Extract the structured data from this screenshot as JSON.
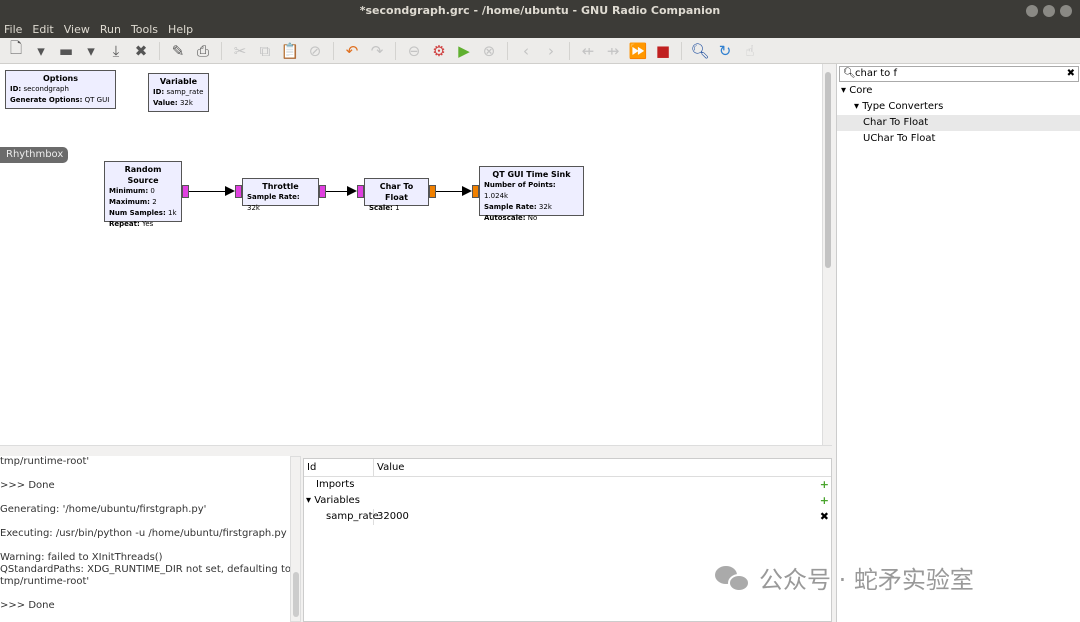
{
  "window": {
    "title": "*secondgraph.grc - /home/ubuntu - GNU Radio Companion"
  },
  "menu": [
    "File",
    "Edit",
    "View",
    "Run",
    "Tools",
    "Help"
  ],
  "toolbar": [
    {
      "icon": "new-file-icon",
      "glyph": "🗋"
    },
    {
      "icon": "dropdown-icon",
      "glyph": "▾"
    },
    {
      "icon": "open-folder-icon",
      "glyph": "▬"
    },
    {
      "icon": "dropdown-icon",
      "glyph": "▾"
    },
    {
      "icon": "save-icon",
      "glyph": "⤓"
    },
    {
      "icon": "close-icon",
      "glyph": "✖"
    },
    {
      "sep": true
    },
    {
      "icon": "pencil-icon",
      "glyph": "✎"
    },
    {
      "icon": "print-icon",
      "glyph": "⎙"
    },
    {
      "sep": true
    },
    {
      "icon": "cut-icon",
      "glyph": "✂",
      "disabled": true
    },
    {
      "icon": "copy-icon",
      "glyph": "⧉",
      "disabled": true
    },
    {
      "icon": "paste-icon",
      "glyph": "📋",
      "disabled": true
    },
    {
      "icon": "delete-icon",
      "glyph": "⊘",
      "disabled": true
    },
    {
      "sep": true
    },
    {
      "icon": "undo-icon",
      "glyph": "↶",
      "color": "#e07020"
    },
    {
      "icon": "redo-icon",
      "glyph": "↷",
      "disabled": true
    },
    {
      "sep": true
    },
    {
      "icon": "disable-icon",
      "glyph": "⊖",
      "disabled": true
    },
    {
      "icon": "generate-icon",
      "glyph": "⚙",
      "color": "#d04040"
    },
    {
      "icon": "execute-icon",
      "glyph": "▶",
      "color": "#60b030"
    },
    {
      "icon": "kill-icon",
      "glyph": "⊗",
      "disabled": true
    },
    {
      "sep": true
    },
    {
      "icon": "rotate-left-icon",
      "glyph": "‹",
      "disabled": true
    },
    {
      "icon": "rotate-right-icon",
      "glyph": "›",
      "disabled": true
    },
    {
      "sep": true
    },
    {
      "icon": "bypass-icon",
      "glyph": "⇷",
      "disabled": true
    },
    {
      "icon": "enable-icon",
      "glyph": "⇸",
      "disabled": true
    },
    {
      "icon": "skip-icon",
      "glyph": "⏩",
      "disabled": true
    },
    {
      "icon": "stop-record-icon",
      "glyph": "■",
      "color": "#c02020"
    },
    {
      "sep": true
    },
    {
      "icon": "find-icon",
      "glyph": "🔍︎",
      "color": "#2050a0"
    },
    {
      "icon": "reload-icon",
      "glyph": "↻",
      "color": "#3080d0"
    },
    {
      "icon": "hand-icon",
      "glyph": "☝",
      "disabled": true
    }
  ],
  "blocks": {
    "options": {
      "title": "Options",
      "params": [
        [
          "ID:",
          "secondgraph"
        ],
        [
          "Generate Options:",
          "QT GUI"
        ]
      ]
    },
    "variable": {
      "title": "Variable",
      "params": [
        [
          "ID:",
          "samp_rate"
        ],
        [
          "Value:",
          "32k"
        ]
      ]
    },
    "random_source": {
      "title": "Random Source",
      "params": [
        [
          "Minimum:",
          "0"
        ],
        [
          "Maximum:",
          "2"
        ],
        [
          "Num Samples:",
          "1k"
        ],
        [
          "Repeat:",
          "Yes"
        ]
      ]
    },
    "throttle": {
      "title": "Throttle",
      "params": [
        [
          "Sample Rate:",
          "32k"
        ]
      ]
    },
    "char_to_float": {
      "title": "Char To Float",
      "params": [
        [
          "Scale:",
          "1"
        ]
      ]
    },
    "time_sink": {
      "title": "QT GUI Time Sink",
      "params": [
        [
          "Number of Points:",
          "1.024k"
        ],
        [
          "Sample Rate:",
          "32k"
        ],
        [
          "Autoscale:",
          "No"
        ]
      ]
    }
  },
  "tooltip": "Rhythmbox",
  "library": {
    "search_value": "char to f",
    "tree": [
      {
        "label": "Core",
        "level": 0,
        "expander": "▾"
      },
      {
        "label": "Type Converters",
        "level": 1,
        "expander": "▾"
      },
      {
        "label": "Char To Float",
        "level": 2,
        "selected": true
      },
      {
        "label": "UChar To Float",
        "level": 2
      }
    ]
  },
  "console": [
    "tmp/runtime-root'",
    "",
    ">>> Done",
    "",
    "Generating: '/home/ubuntu/firstgraph.py'",
    "",
    "Executing: /usr/bin/python -u /home/ubuntu/firstgraph.py",
    "",
    "Warning: failed to XInitThreads()",
    "QStandardPaths: XDG_RUNTIME_DIR not set, defaulting to '/",
    "tmp/runtime-root'",
    "",
    ">>> Done"
  ],
  "variables": {
    "headers": [
      "Id",
      "Value"
    ],
    "rows": [
      {
        "id": "Imports",
        "value": "",
        "indent": 1,
        "action": "+"
      },
      {
        "id": "Variables",
        "value": "",
        "indent": 0,
        "expander": "▾",
        "action": "+"
      },
      {
        "id": "samp_rate",
        "value": "32000",
        "indent": 2,
        "action": "✖"
      }
    ]
  },
  "watermark": "公众号 · 蛇矛实验室",
  "colors": {
    "block_bg": "#eeeeff",
    "port_byte": "#e040e0",
    "port_float": "#f08000",
    "titlebar": "#3c3b37"
  }
}
